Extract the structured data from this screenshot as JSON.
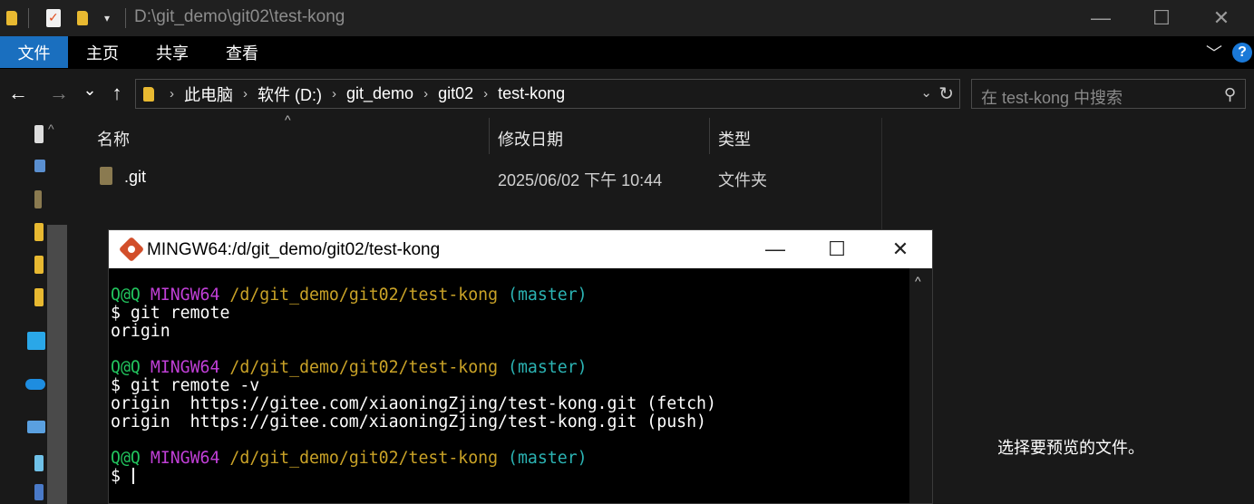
{
  "window": {
    "title": "D:\\git_demo\\git02\\test-kong",
    "minimize_glyph": "—",
    "maximize_glyph": "☐",
    "close_glyph": "✕"
  },
  "ribbon": {
    "tabs": [
      {
        "label": "文件"
      },
      {
        "label": "主页"
      },
      {
        "label": "共享"
      },
      {
        "label": "查看"
      }
    ],
    "expand_glyph": "﹀",
    "help_glyph": "?"
  },
  "nav": {
    "back_glyph": "←",
    "forward_glyph": "→",
    "recent_glyph": "⌄",
    "up_glyph": "↑",
    "breadcrumbs": [
      {
        "label": "此电脑"
      },
      {
        "label": "软件 (D:)"
      },
      {
        "label": "git_demo"
      },
      {
        "label": "git02"
      },
      {
        "label": "test-kong"
      }
    ],
    "crumb_sep": "›",
    "dropdown_glyph": "⌄",
    "refresh_glyph": "↻",
    "search_placeholder": "在 test-kong 中搜索",
    "search_glyph": "⚲"
  },
  "filelist": {
    "columns": {
      "name": "名称",
      "date": "修改日期",
      "type": "类型"
    },
    "sort_glyph": "^",
    "rows": [
      {
        "name": ".git",
        "date": "2025/06/02 下午 10:44",
        "type": "文件夹"
      }
    ]
  },
  "preview": {
    "message": "选择要预览的文件。"
  },
  "terminal": {
    "title": "MINGW64:/d/git_demo/git02/test-kong",
    "minimize_glyph": "—",
    "maximize_glyph": "☐",
    "close_glyph": "✕",
    "scroll_glyph": "^",
    "prompt_user": "Q@Q",
    "prompt_env": "MINGW64",
    "prompt_path": "/d/git_demo/git02/test-kong",
    "prompt_branch": "(master)",
    "lines": {
      "cmd1": "$ git remote",
      "out1": "origin",
      "cmd2": "$ git remote -v",
      "out2a": "origin  https://gitee.com/xiaoningZjing/test-kong.git (fetch)",
      "out2b": "origin  https://gitee.com/xiaoningZjing/test-kong.git (push)",
      "prompt_end": "$ "
    }
  },
  "colors": {
    "ribbon_file_tab": "#1a6fbf",
    "folder": "#e8b931",
    "term_green": "#22c55e",
    "term_magenta": "#c03fd6",
    "term_yellow": "#c9a227",
    "term_cyan": "#2bb3b3"
  }
}
